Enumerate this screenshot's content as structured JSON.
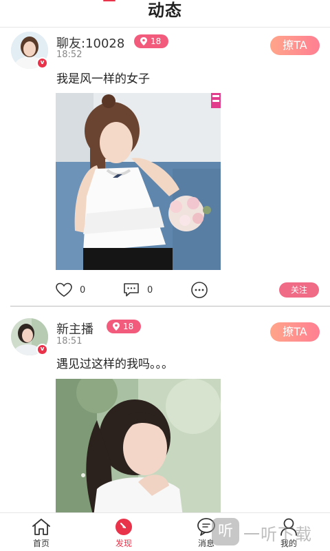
{
  "header": {
    "title": "动态"
  },
  "posts": [
    {
      "username": "聊友:10028",
      "level": "18",
      "time": "18:52",
      "flirt_label": "撩TA",
      "content": "我是风一样的女子",
      "likes": "0",
      "comments": "0",
      "follow_label": "关注"
    },
    {
      "username": "新主播",
      "level": "18",
      "time": "18:51",
      "flirt_label": "撩TA",
      "content": "遇见过这样的我吗。。。"
    }
  ],
  "tabbar": {
    "items": [
      {
        "label": "首页",
        "icon": "home-icon"
      },
      {
        "label": "发现",
        "icon": "discover-icon",
        "active": true
      },
      {
        "label": "消息",
        "icon": "message-icon"
      },
      {
        "label": "我的",
        "icon": "profile-icon"
      }
    ]
  },
  "watermark": {
    "icon_text": "听",
    "text": "一听下载"
  },
  "colors": {
    "accent": "#e8334a",
    "badge": "#f35b7c",
    "follow": "#f06b86",
    "flirt_start": "#ffa58a",
    "flirt_end": "#ff7f92"
  }
}
